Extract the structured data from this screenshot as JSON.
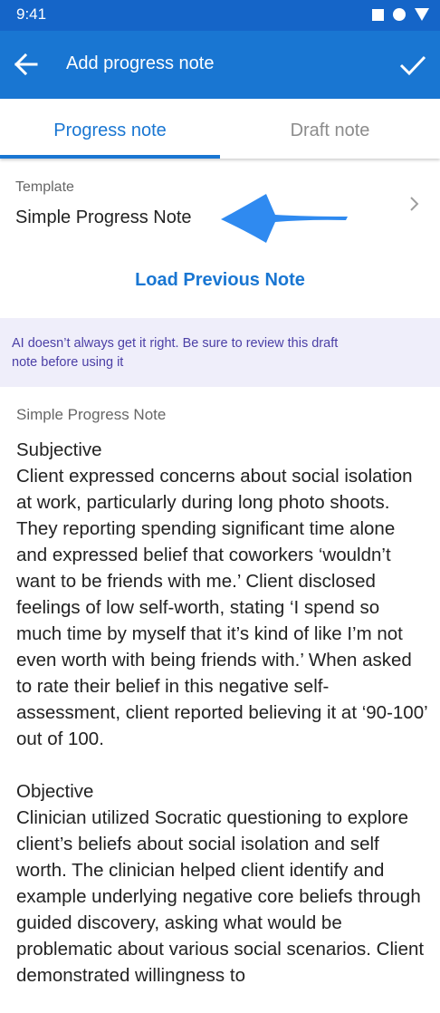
{
  "status_bar": {
    "time": "9:41"
  },
  "app_bar": {
    "title": "Add progress note"
  },
  "tabs": [
    {
      "label": "Progress note",
      "active": true
    },
    {
      "label": "Draft note",
      "active": false
    }
  ],
  "template": {
    "label": "Template",
    "value": "Simple Progress Note"
  },
  "load_previous_label": "Load Previous Note",
  "ai_notice": "AI doesn’t always get it right. Be sure to review this draft note before using it",
  "note": {
    "title": "Simple Progress Note",
    "subjective_heading": "Subjective",
    "subjective_text": "Client expressed concerns about social isolation at work, particularly during long photo shoots. They reporting spending significant time alone and expressed belief that coworkers ‘wouldn’t want to be friends with me.’ Client disclosed feelings of low self-worth, stating ‘I spend so much time by myself that it’s kind of like I’m not even worth with being friends with.’ When asked to rate their belief in this negative self-assessment, client reported believing it at ‘90-100’ out of 100.",
    "objective_heading": "Objective",
    "objective_text": "Clinician utilized Socratic questioning to explore client’s beliefs about social isolation and self worth. The clinician helped client identify and example underlying negative core beliefs through guided discovery, asking what would be problematic about various social scenarios. Client demonstrated willingness to"
  },
  "colors": {
    "primary": "#1976d2",
    "status_bar": "#1565c8",
    "ai_banner_bg": "#efeefa",
    "ai_text": "#4b3fa6",
    "annotation_arrow": "#2f8af0"
  }
}
